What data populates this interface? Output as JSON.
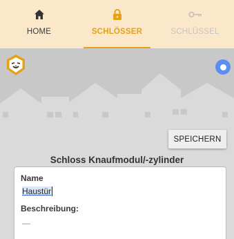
{
  "tabs": [
    {
      "label": "HOME",
      "icon": "home-icon",
      "active": false
    },
    {
      "label": "SCHLÖSSER",
      "icon": "lock-icon",
      "active": true
    },
    {
      "label": "SCHLÜSSEL",
      "icon": "key-icon",
      "active": false
    }
  ],
  "colors": {
    "tabbar_bg": "#fbe7c9",
    "accent": "#e3a21a",
    "status_dot": "#5b8ef0"
  },
  "header": {
    "logo_icon": "lion-logo-icon",
    "status_icon": "status-ring-icon"
  },
  "toolbar": {
    "save_label": "SPEICHERN"
  },
  "section": {
    "title": "Schloss Knaufmodul/-zylinder"
  },
  "form": {
    "name_label": "Name",
    "name_value": "Haustür",
    "description_label": "Beschreibung:",
    "description_value": "—"
  }
}
